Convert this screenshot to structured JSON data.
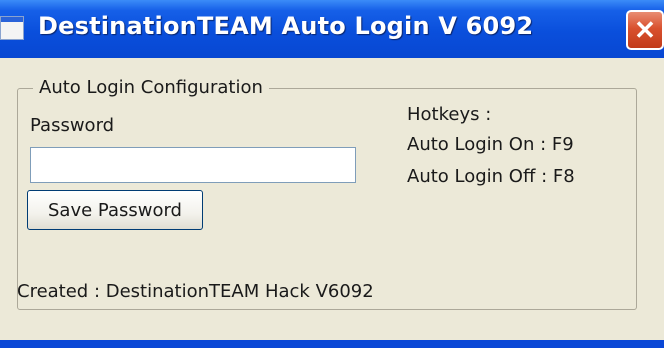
{
  "window": {
    "title": "DestinationTEAM Auto Login V 6092",
    "close_glyph": "✕",
    "title_bar_color": "#0a4fdc",
    "close_button_color": "#d9512f",
    "client_color": "#ece9d8"
  },
  "config": {
    "group_label": "Auto Login Configuration",
    "password_label": "Password",
    "password_value": "",
    "save_button_label": "Save Password"
  },
  "hotkeys": {
    "title": "Hotkeys :",
    "on": "Auto Login On : F9",
    "off": "Auto Login Off : F8"
  },
  "footer": {
    "created": "Created : DestinationTEAM Hack V6092"
  },
  "icons": {
    "app": "window-app-icon",
    "close": "close-icon"
  }
}
